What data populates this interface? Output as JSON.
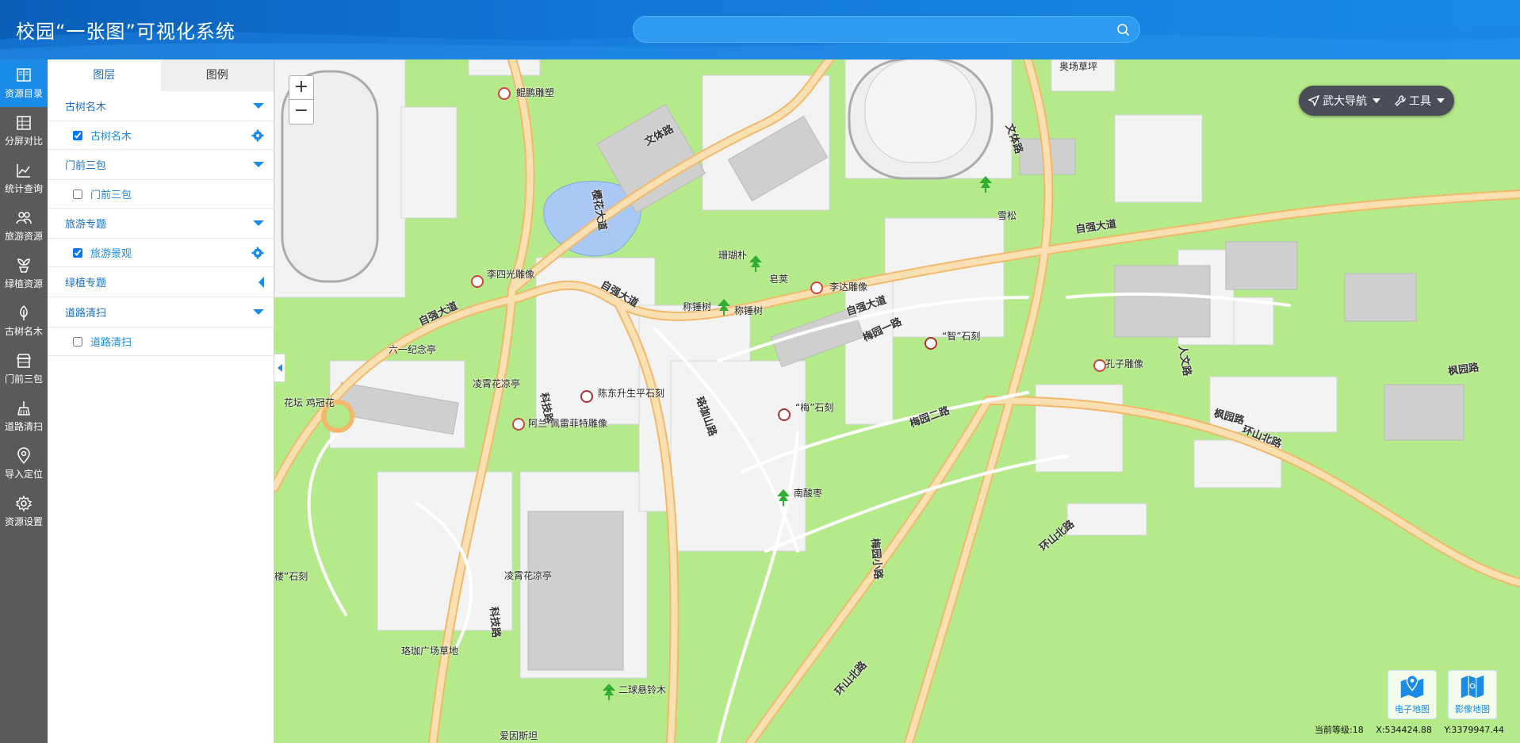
{
  "app": {
    "title": "校园“一张图”可视化系统"
  },
  "search": {
    "placeholder": "",
    "value": ""
  },
  "rail": {
    "items": [
      {
        "label": "资源目录",
        "icon": "book-icon",
        "active": true
      },
      {
        "label": "分屏对比",
        "icon": "grid-icon",
        "active": false
      },
      {
        "label": "统计查询",
        "icon": "chart-icon",
        "active": false
      },
      {
        "label": "旅游资源",
        "icon": "people-icon",
        "active": false
      },
      {
        "label": "绿植资源",
        "icon": "plant-icon",
        "active": false
      },
      {
        "label": "古树名木",
        "icon": "tree-icon",
        "active": false
      },
      {
        "label": "门前三包",
        "icon": "shop-icon",
        "active": false
      },
      {
        "label": "道路清扫",
        "icon": "broom-icon",
        "active": false
      },
      {
        "label": "导入定位",
        "icon": "location-pin-icon",
        "active": false
      },
      {
        "label": "资源设置",
        "icon": "gear-icon",
        "active": false
      }
    ]
  },
  "panel": {
    "tabs": [
      {
        "label": "图层",
        "active": true
      },
      {
        "label": "图例",
        "active": false
      }
    ],
    "groups": [
      {
        "label": "古树名木",
        "expanded": true,
        "layers": [
          {
            "label": "古树名木",
            "checked": true,
            "settings": true
          }
        ]
      },
      {
        "label": "门前三包",
        "expanded": true,
        "layers": [
          {
            "label": "门前三包",
            "checked": false,
            "settings": false
          }
        ]
      },
      {
        "label": "旅游专题",
        "expanded": true,
        "layers": [
          {
            "label": "旅游景观",
            "checked": true,
            "settings": true
          }
        ]
      },
      {
        "label": "绿植专题",
        "expanded": false,
        "layers": []
      },
      {
        "label": "道路清扫",
        "expanded": true,
        "layers": [
          {
            "label": "道路清扫",
            "checked": false,
            "settings": false
          }
        ]
      }
    ]
  },
  "map": {
    "zoom_in": "+",
    "zoom_out": "−",
    "tools": {
      "nav_label": "武大导航",
      "tool_label": "工具"
    },
    "map_types": {
      "vector": "电子地图",
      "image": "影像地图"
    },
    "status": {
      "level": "当前等级:18",
      "x": "X:534424.88",
      "y": "Y:3379947.44"
    },
    "place_labels": [
      "奥场草坪",
      "鲲鹏雕塑",
      "雪松",
      "珊瑚朴",
      "皂荚",
      "李达雕像",
      "称锤树",
      "称锤树",
      "李四光雕像",
      "六一纪念亭",
      "凌霄花凉亭",
      "陈东升生平石刻",
      "阿兰·佩雷菲特雕像",
      "花坛 鸡冠花",
      "“智”石刻",
      "孔子雕像",
      "“梅”石刻",
      "南酸枣",
      "凌霄花凉亭",
      "珞珈广场草地",
      "二球悬铃木",
      "爱因斯坦",
      "楼”石刻"
    ],
    "road_labels": [
      "文体路",
      "樱花大道",
      "自强大道",
      "自强大道",
      "自强大道",
      "自强大道",
      "科技路",
      "科技路",
      "珞珈山路",
      "梅园一路",
      "梅园二路",
      "梅园小路",
      "人文路",
      "文体路",
      "环山北路",
      "环山北路",
      "环山北路",
      "枫园路",
      "枫园路"
    ]
  }
}
